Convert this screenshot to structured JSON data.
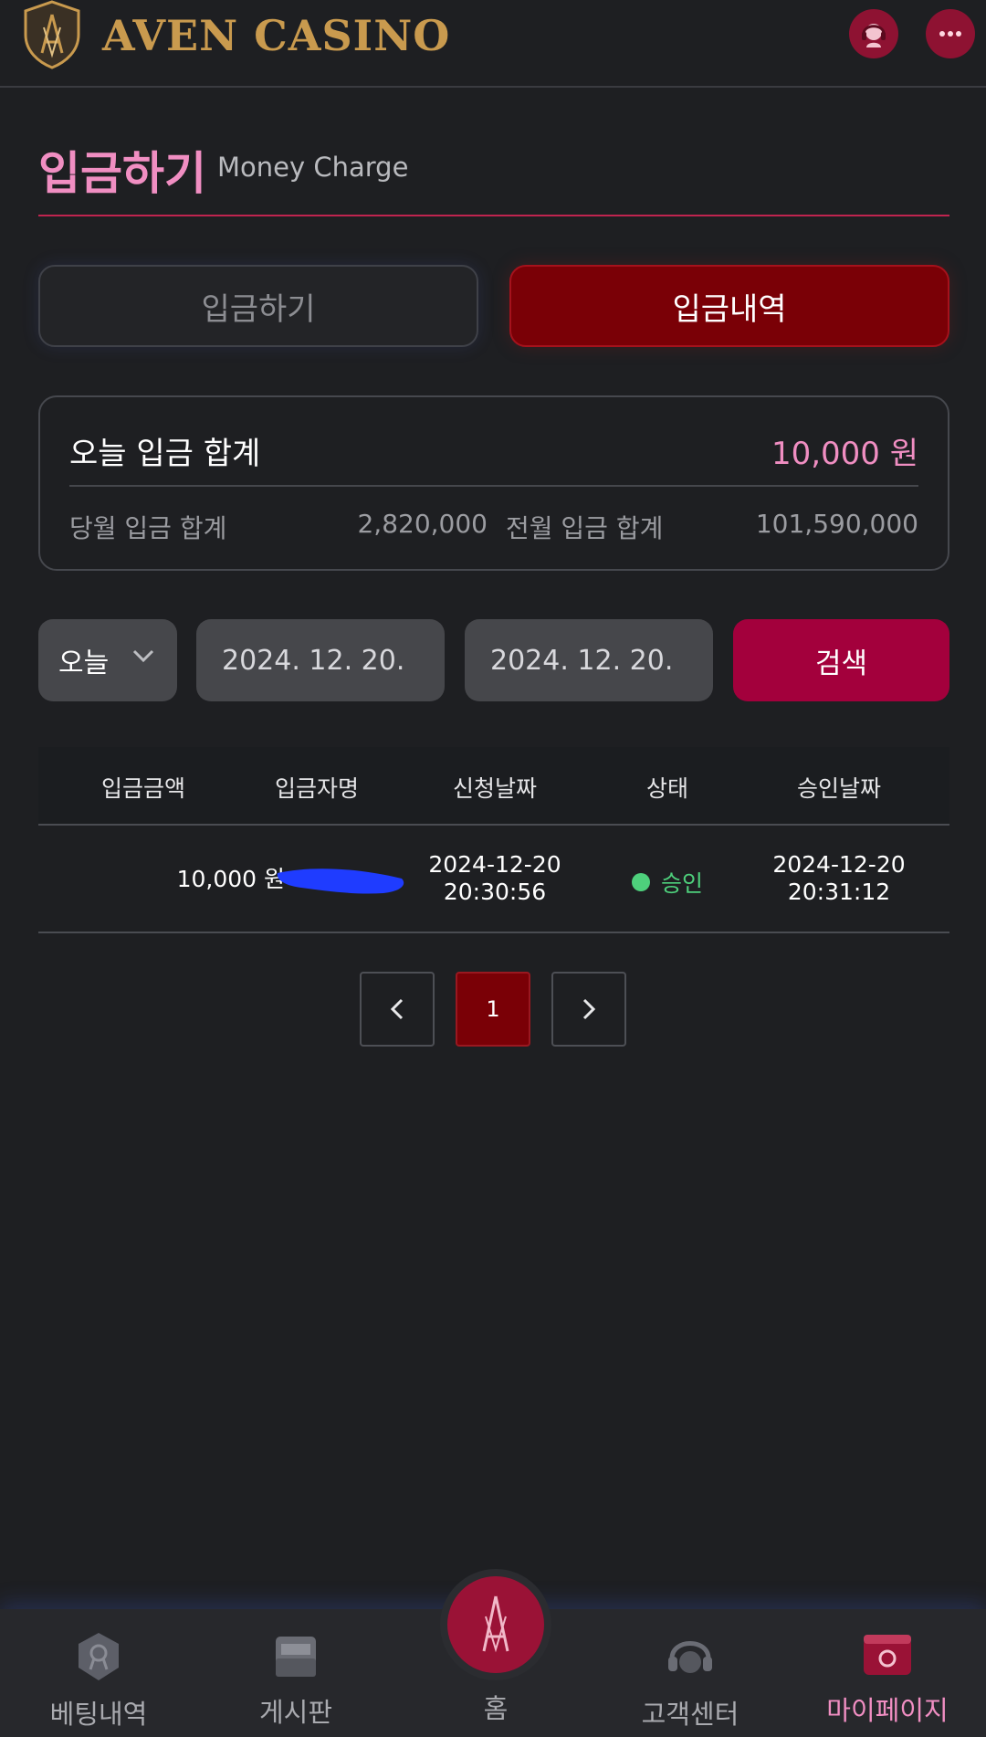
{
  "header": {
    "brand": "AVEN CASINO",
    "support_icon": "headset-icon",
    "chat_icon": "chat-bubble-icon",
    "accent": "#c99a4e"
  },
  "page": {
    "title": "입금하기",
    "subtitle": "Money Charge"
  },
  "tabs": [
    {
      "label": "입금하기",
      "active": false
    },
    {
      "label": "입금내역",
      "active": true
    }
  ],
  "summary": {
    "today_label": "오늘 입금 합계",
    "today_value": "10,000 원",
    "month_label": "당월 입금 합계",
    "month_value": "2,820,000",
    "prev_month_label": "전월 입금 합계",
    "prev_month_value": "101,590,000"
  },
  "filter": {
    "period_selected": "오늘",
    "start_date": "2024. 12. 20.",
    "end_date": "2024. 12. 20.",
    "search_label": "검색"
  },
  "table": {
    "columns": [
      "입금금액",
      "입금자명",
      "신청날짜",
      "상태",
      "승인날짜"
    ],
    "rows": [
      {
        "amount": "10,000 원",
        "depositor": "",
        "request_date": "2024-12-20",
        "request_time": "20:30:56",
        "status": "승인",
        "approve_date": "2024-12-20",
        "approve_time": "20:31:12"
      }
    ]
  },
  "pagination": {
    "current": "1"
  },
  "bottom_nav": [
    {
      "label": "베팅내역",
      "icon": "ribbon-badge-icon"
    },
    {
      "label": "게시판",
      "icon": "folder-icon"
    },
    {
      "label": "홈",
      "icon": "logo-home-icon"
    },
    {
      "label": "고객센터",
      "icon": "headset-icon"
    },
    {
      "label": "마이페이지",
      "icon": "mypage-card-icon",
      "active": true
    }
  ],
  "colors": {
    "pink": "#f08ec2",
    "crimson": "#a3003c",
    "dark_red": "#7a0006",
    "approved_green": "#4ed07c"
  }
}
